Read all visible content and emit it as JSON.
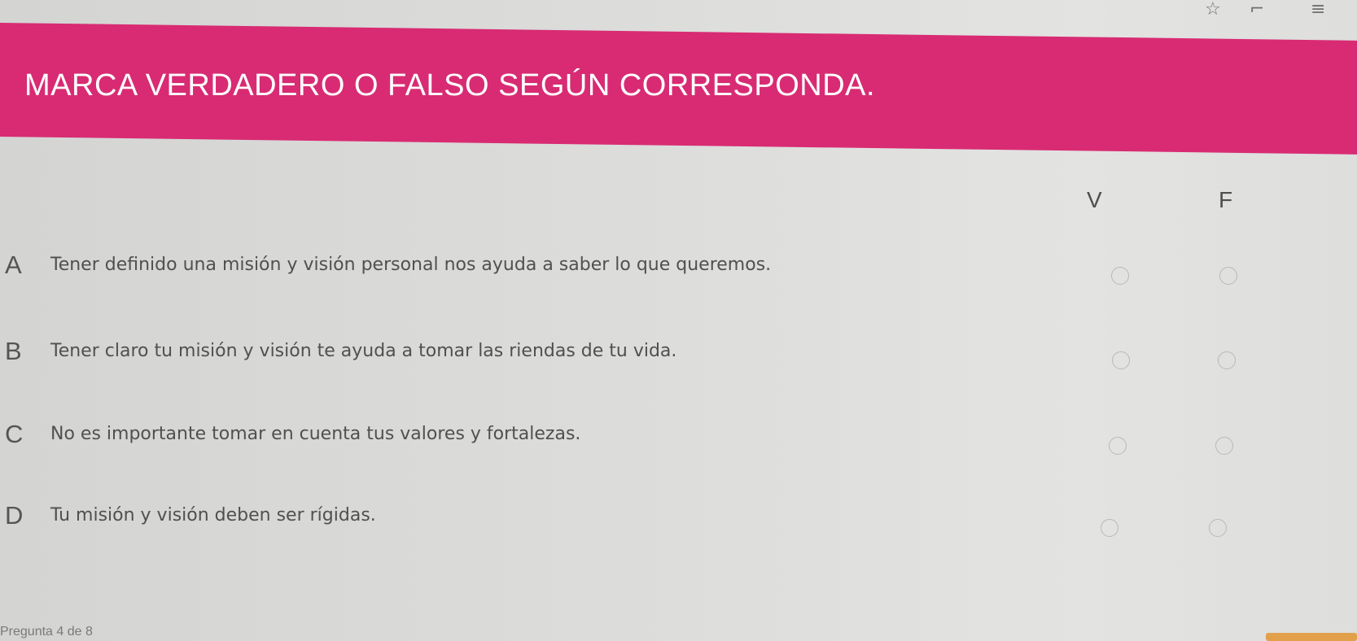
{
  "toolbar": {
    "icons": [
      "star-icon",
      "expand-icon",
      "queue-icon"
    ],
    "glyphs": [
      "☆",
      "⌐",
      "≡"
    ]
  },
  "banner": {
    "title": "MARCA VERDADERO O FALSO SEGÚN CORRESPONDA.",
    "color": "#d82b73"
  },
  "columns": {
    "true_label": "V",
    "false_label": "F"
  },
  "questions": [
    {
      "letter": "A",
      "text": "Tener definido una misión y visión personal nos ayuda a saber lo que queremos."
    },
    {
      "letter": "B",
      "text": "Tener claro tu misión y visión te ayuda a tomar las riendas de tu vida."
    },
    {
      "letter": "C",
      "text": "No es importante tomar en cuenta tus valores y fortalezas."
    },
    {
      "letter": "D",
      "text": "Tu misión y visión deben ser rígidas."
    }
  ],
  "footer": {
    "progress_text": "Pregunta 4 de 8"
  }
}
